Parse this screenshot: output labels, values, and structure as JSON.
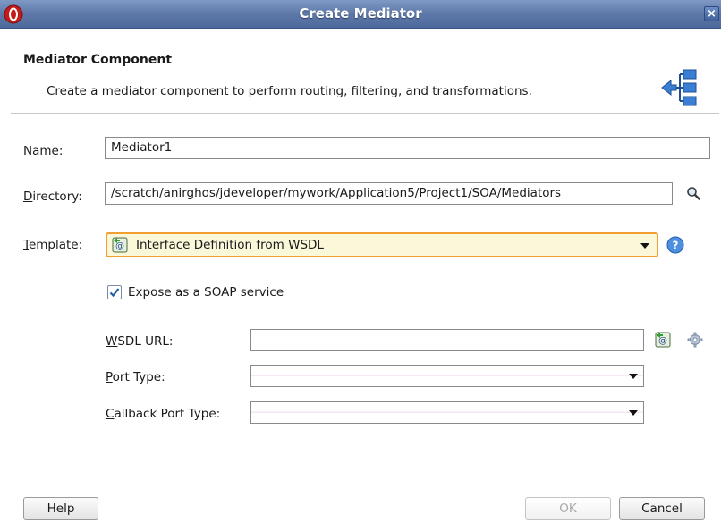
{
  "window": {
    "title": "Create Mediator",
    "close_glyph": "×"
  },
  "header": {
    "title": "Mediator Component",
    "description": "Create a mediator component to perform routing, filtering, and transformations."
  },
  "form": {
    "name": {
      "label_mnemonic": "N",
      "label_rest": "ame:",
      "value": "Mediator1"
    },
    "directory": {
      "label_mnemonic": "D",
      "label_rest": "irectory:",
      "value": "/scratch/anirghos/jdeveloper/mywork/Application5/Project1/SOA/Mediators"
    },
    "template": {
      "label_mnemonic": "T",
      "label_rest": "emplate:",
      "value": "Interface Definition from WSDL"
    },
    "expose_soap": {
      "label": "Expose as a SOAP service",
      "checked": true
    },
    "wsdl_url": {
      "label_mnemonic": "W",
      "label_rest": "SDL URL:",
      "value": ""
    },
    "port_type": {
      "label_mnemonic": "P",
      "label_rest": "ort Type:",
      "value": ""
    },
    "callback_port_type": {
      "label_mnemonic": "C",
      "label_rest": "allback Port Type:",
      "value": ""
    }
  },
  "buttons": {
    "help": "Help",
    "ok": "OK",
    "cancel": "Cancel"
  },
  "colors": {
    "titlebar": "#5d78a8",
    "template_highlight_border": "#f0a030",
    "template_highlight_bg": "#fbf7d9"
  },
  "icons": {
    "app": "oracle-app-icon",
    "header": "mediator-routing-icon",
    "search": "search-icon",
    "help": "help-icon",
    "wsdl_browse": "wsdl-browse-icon",
    "wsdl_generate": "gear-icon"
  }
}
